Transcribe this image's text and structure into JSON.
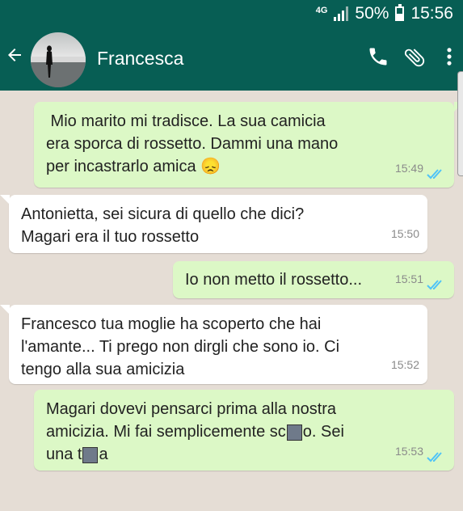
{
  "status_bar": {
    "network": "4G",
    "battery": "50%",
    "battery_level": 0.5,
    "time": "15:56"
  },
  "header": {
    "contact_name": "Francesca"
  },
  "colors": {
    "header": "#075e54",
    "chat_bg": "#e5ddd5",
    "outgoing": "#dcf8c6",
    "incoming": "#ffffff",
    "read_ticks": "#4fc3f7"
  },
  "icons": {
    "back": "back-arrow-icon",
    "call": "phone-icon",
    "attach": "paperclip-icon",
    "menu": "more-vert-icon",
    "read": "double-check-icon"
  },
  "messages": [
    {
      "direction": "out",
      "lines": [
        " Mio marito mi tradisce. La sua camicia",
        "era sporca di rossetto. Dammi una mano",
        "per incastrarlo amica"
      ],
      "emoji": "😞",
      "time": "15:49",
      "read": true
    },
    {
      "direction": "in",
      "lines": [
        "Antonietta, sei sicura di quello che dici?",
        "Magari era il tuo rossetto"
      ],
      "time": "15:50"
    },
    {
      "direction": "out",
      "lines": [
        "Io non metto il rossetto..."
      ],
      "time": "15:51",
      "read": true
    },
    {
      "direction": "in",
      "lines": [
        "Francesco tua moglie ha scoperto che hai",
        "l'amante... Ti prego non dirgli che sono io. Ci",
        "tengo alla sua amicizia"
      ],
      "time": "15:52"
    },
    {
      "direction": "out",
      "lines": [
        "Magari dovevi pensarci prima alla nostra",
        "amicizia. Mi fai semplicemente sc",
        "o. Sei",
        "una t",
        "a"
      ],
      "time": "15:53",
      "read": true
    }
  ]
}
